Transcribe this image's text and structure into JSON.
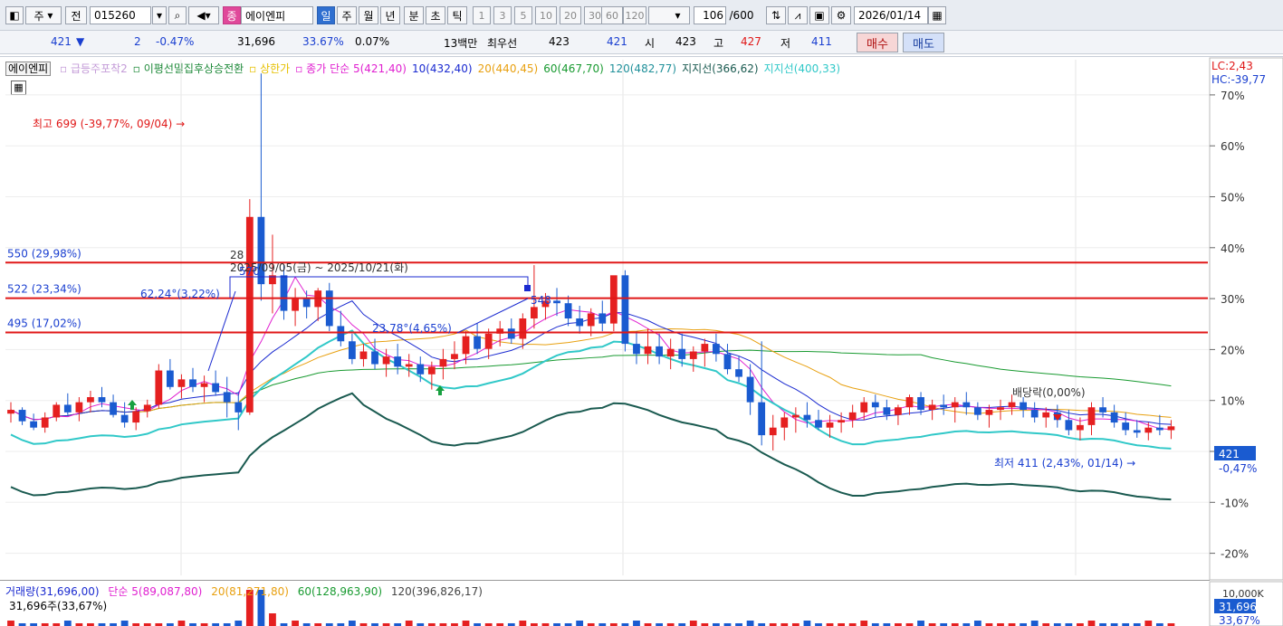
{
  "toolbar": {
    "market": "주",
    "prev_label": "전",
    "code": "015260",
    "stock_badge": "종",
    "stock_name": "에이엔피",
    "periods": [
      "일",
      "주",
      "월",
      "년",
      "분",
      "초",
      "틱"
    ],
    "active_period": "일",
    "intervals": [
      "1",
      "3",
      "5",
      "10",
      "20",
      "30",
      "60",
      "120"
    ],
    "count": "106",
    "count_total": "/600",
    "date": "2026/01/14"
  },
  "quote": {
    "price": "421",
    "arrow": "▼",
    "change": "2",
    "change_pct": "-0.47%",
    "volume": "31,696",
    "volume_pct": "33.67%",
    "turnover": "0.07%",
    "amount": "13백만",
    "best_label": "최우선",
    "best_ask": "423",
    "best_bid": "421",
    "open_label": "시",
    "open": "423",
    "high_label": "고",
    "high": "427",
    "low_label": "저",
    "low": "411",
    "buy_label": "매수",
    "sell_label": "매도"
  },
  "legend": {
    "name": "에이엔피",
    "items": [
      {
        "text": "급등주포착2",
        "color": "#c49cd8"
      },
      {
        "text": "이평선밀집후상승전환",
        "color": "#1f8a3a"
      },
      {
        "text": "상한가",
        "color": "#e6c000"
      },
      {
        "text": "종가 단순 5(421,40)",
        "color": "#e020d0"
      },
      {
        "text": "10(432,40)",
        "color": "#1a2ad0"
      },
      {
        "text": "20(440,45)",
        "color": "#e8a010"
      },
      {
        "text": "60(467,70)",
        "color": "#189a30"
      },
      {
        "text": "120(482,77)",
        "color": "#20909a"
      },
      {
        "text": "지지선(366,62)",
        "color": "#1a5a50"
      },
      {
        "text": "지지선(400,33)",
        "color": "#30c8c8"
      }
    ]
  },
  "right_axis": {
    "lc": "LC:2,43",
    "hc": "HC:-39,77",
    "ticks": [
      "70%",
      "60%",
      "50%",
      "40%",
      "30%",
      "20%",
      "10%",
      "0%",
      "-10%",
      "-20%"
    ],
    "price_tag": "421",
    "pct_tag": "-0,47%"
  },
  "annotations": {
    "high": "최고 699 (-39,77%, 09/04)",
    "low": "최저 411 (2,43%, 01/14)",
    "dividend": "배당락(0,00%)",
    "period_count": "28",
    "period_range": "2025/09/05(금) ~ 2025/10/21(화)",
    "angle1": "62,24°(3,22%)",
    "angle2": "23,78°(4,65%)",
    "v570": "570",
    "v548": "548",
    "h550": "550 (29,98%)",
    "h522": "522 (23,34%)",
    "h495": "495 (17,02%)"
  },
  "volume_legend": {
    "title": "거래량(31,696,00)",
    "ma5": "단순 5(89,087,80)",
    "ma20": "20(81,271,80)",
    "ma60": "60(128,963,90)",
    "ma120": "120(396,826,17)",
    "current": "31,696주(33,67%)",
    "tag_top": "10,000K",
    "tag_val": "31,696",
    "tag_pct": "33,67%"
  },
  "colors": {
    "up": "#e52020",
    "down": "#1a5bd0",
    "hline": "#e01818"
  },
  "chart_data": {
    "type": "candlestick",
    "dates_shown": [
      "2025/09/04",
      "2026/01/14"
    ],
    "ohlc": [
      [
        431,
        440,
        424,
        434
      ],
      [
        434,
        436,
        422,
        425
      ],
      [
        425,
        431,
        418,
        420
      ],
      [
        420,
        432,
        416,
        428
      ],
      [
        428,
        440,
        425,
        438
      ],
      [
        438,
        447,
        430,
        432
      ],
      [
        432,
        444,
        425,
        440
      ],
      [
        440,
        449,
        432,
        444
      ],
      [
        444,
        452,
        436,
        440
      ],
      [
        440,
        446,
        428,
        430
      ],
      [
        430,
        440,
        420,
        424
      ],
      [
        424,
        436,
        418,
        433
      ],
      [
        433,
        442,
        428,
        438
      ],
      [
        438,
        470,
        435,
        465
      ],
      [
        465,
        474,
        450,
        452
      ],
      [
        452,
        462,
        443,
        458
      ],
      [
        458,
        467,
        448,
        452
      ],
      [
        452,
        461,
        440,
        455
      ],
      [
        455,
        465,
        445,
        448
      ],
      [
        448,
        460,
        428,
        440
      ],
      [
        440,
        448,
        418,
        432
      ],
      [
        432,
        600,
        430,
        586
      ],
      [
        586,
        699,
        520,
        533
      ],
      [
        533,
        572,
        510,
        540
      ],
      [
        540,
        548,
        505,
        512
      ],
      [
        512,
        530,
        500,
        522
      ],
      [
        522,
        528,
        506,
        515
      ],
      [
        515,
        530,
        504,
        528
      ],
      [
        528,
        534,
        496,
        500
      ],
      [
        500,
        512,
        484,
        488
      ],
      [
        488,
        494,
        470,
        474
      ],
      [
        474,
        486,
        468,
        480
      ],
      [
        480,
        490,
        466,
        470
      ],
      [
        470,
        482,
        460,
        476
      ],
      [
        476,
        486,
        462,
        468
      ],
      [
        468,
        478,
        460,
        470
      ],
      [
        470,
        476,
        456,
        462
      ],
      [
        462,
        472,
        450,
        468
      ],
      [
        468,
        482,
        458,
        474
      ],
      [
        474,
        488,
        466,
        478
      ],
      [
        478,
        496,
        470,
        492
      ],
      [
        492,
        502,
        478,
        482
      ],
      [
        482,
        498,
        474,
        494
      ],
      [
        494,
        504,
        484,
        498
      ],
      [
        498,
        506,
        486,
        490
      ],
      [
        490,
        510,
        482,
        506
      ],
      [
        506,
        548,
        498,
        515
      ],
      [
        515,
        526,
        505,
        520
      ],
      [
        520,
        530,
        508,
        518
      ],
      [
        518,
        524,
        500,
        506
      ],
      [
        506,
        516,
        494,
        500
      ],
      [
        500,
        514,
        492,
        510
      ],
      [
        510,
        520,
        496,
        502
      ],
      [
        502,
        536,
        496,
        540
      ],
      [
        540,
        544,
        480,
        486
      ],
      [
        486,
        496,
        470,
        478
      ],
      [
        478,
        498,
        470,
        484
      ],
      [
        484,
        494,
        470,
        476
      ],
      [
        476,
        490,
        466,
        482
      ],
      [
        482,
        494,
        468,
        474
      ],
      [
        474,
        484,
        464,
        480
      ],
      [
        480,
        490,
        468,
        486
      ],
      [
        486,
        494,
        472,
        478
      ],
      [
        478,
        486,
        462,
        466
      ],
      [
        466,
        476,
        456,
        460
      ],
      [
        460,
        470,
        430,
        440
      ],
      [
        440,
        488,
        406,
        414
      ],
      [
        414,
        430,
        402,
        420
      ],
      [
        420,
        432,
        410,
        428
      ],
      [
        428,
        436,
        416,
        430
      ],
      [
        430,
        440,
        420,
        426
      ],
      [
        426,
        434,
        418,
        420
      ],
      [
        420,
        430,
        412,
        424
      ],
      [
        424,
        432,
        416,
        426
      ],
      [
        426,
        438,
        420,
        432
      ],
      [
        432,
        444,
        426,
        440
      ],
      [
        440,
        446,
        428,
        436
      ],
      [
        436,
        442,
        426,
        430
      ],
      [
        430,
        438,
        422,
        436
      ],
      [
        436,
        446,
        430,
        444
      ],
      [
        444,
        448,
        430,
        434
      ],
      [
        434,
        442,
        426,
        438
      ],
      [
        438,
        446,
        430,
        436
      ],
      [
        436,
        444,
        424,
        440
      ],
      [
        440,
        448,
        430,
        436
      ],
      [
        436,
        440,
        426,
        430
      ],
      [
        430,
        438,
        420,
        434
      ],
      [
        434,
        442,
        426,
        436
      ],
      [
        436,
        446,
        430,
        440
      ],
      [
        440,
        444,
        428,
        434
      ],
      [
        434,
        440,
        424,
        428
      ],
      [
        428,
        436,
        420,
        432
      ],
      [
        432,
        438,
        420,
        426
      ],
      [
        426,
        434,
        414,
        418
      ],
      [
        418,
        428,
        410,
        422
      ],
      [
        422,
        440,
        414,
        436
      ],
      [
        436,
        444,
        428,
        432
      ],
      [
        432,
        438,
        420,
        424
      ],
      [
        424,
        432,
        414,
        418
      ],
      [
        418,
        426,
        412,
        416
      ],
      [
        416,
        424,
        410,
        420
      ],
      [
        420,
        430,
        414,
        418
      ],
      [
        418,
        426,
        411,
        421
      ]
    ]
  }
}
